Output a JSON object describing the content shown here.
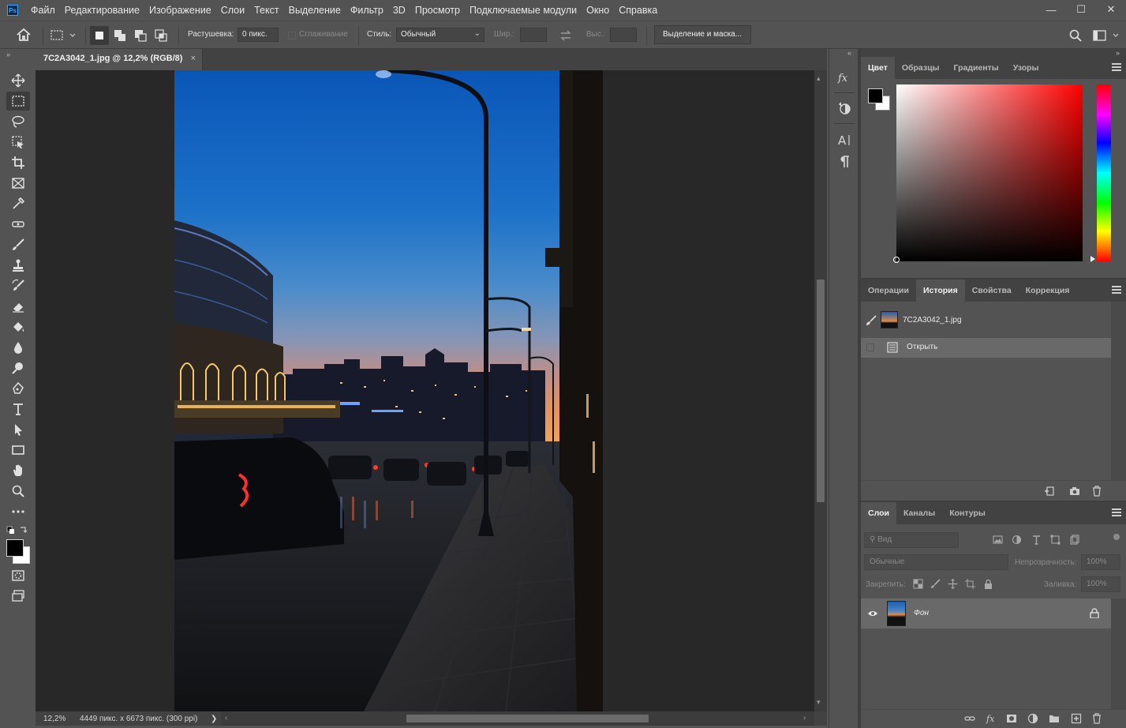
{
  "app": {
    "logo": "Ps"
  },
  "menu": [
    "Файл",
    "Редактирование",
    "Изображение",
    "Слои",
    "Текст",
    "Выделение",
    "Фильтр",
    "3D",
    "Просмотр",
    "Подключаемые модули",
    "Окно",
    "Справка"
  ],
  "window_controls": {
    "minimize": "—",
    "maximize": "☐",
    "close": "✕"
  },
  "options": {
    "feather_label": "Растушевка:",
    "feather_value": "0 пикс.",
    "antialias_label": "Сглаживание",
    "style_label": "Стиль:",
    "style_value": "Обычный",
    "width_label": "Шир.:",
    "height_label": "Выс.:",
    "select_mask_button": "Выделение и маска..."
  },
  "document": {
    "tab_title": "7C2A3042_1.jpg @ 12,2% (RGB/8)",
    "tab_close": "×",
    "zoom": "12,2%",
    "info": "4449 пикс. x 6673 пикс. (300 ppi)",
    "info_arrow": "❯"
  },
  "color_panel": {
    "tabs": [
      "Цвет",
      "Образцы",
      "Градиенты",
      "Узоры"
    ],
    "active_tab": 0,
    "foreground": "#000000",
    "background": "#ffffff",
    "hue": "#ff0000"
  },
  "history_panel": {
    "tabs": [
      "Операции",
      "История",
      "Свойства",
      "Коррекция"
    ],
    "active_tab": 1,
    "snapshot_name": "7C2A3042_1.jpg",
    "steps": [
      "Открыть"
    ]
  },
  "layers_panel": {
    "tabs": [
      "Слои",
      "Каналы",
      "Контуры"
    ],
    "active_tab": 0,
    "search_placeholder": "Вид",
    "blend_mode": "Обычные",
    "opacity_label": "Непрозрачность:",
    "opacity_value": "100%",
    "lock_label": "Закрепить:",
    "fill_label": "Заливка:",
    "fill_value": "100%",
    "layers": [
      {
        "name": "Фон",
        "visible": true,
        "locked": true
      }
    ]
  }
}
